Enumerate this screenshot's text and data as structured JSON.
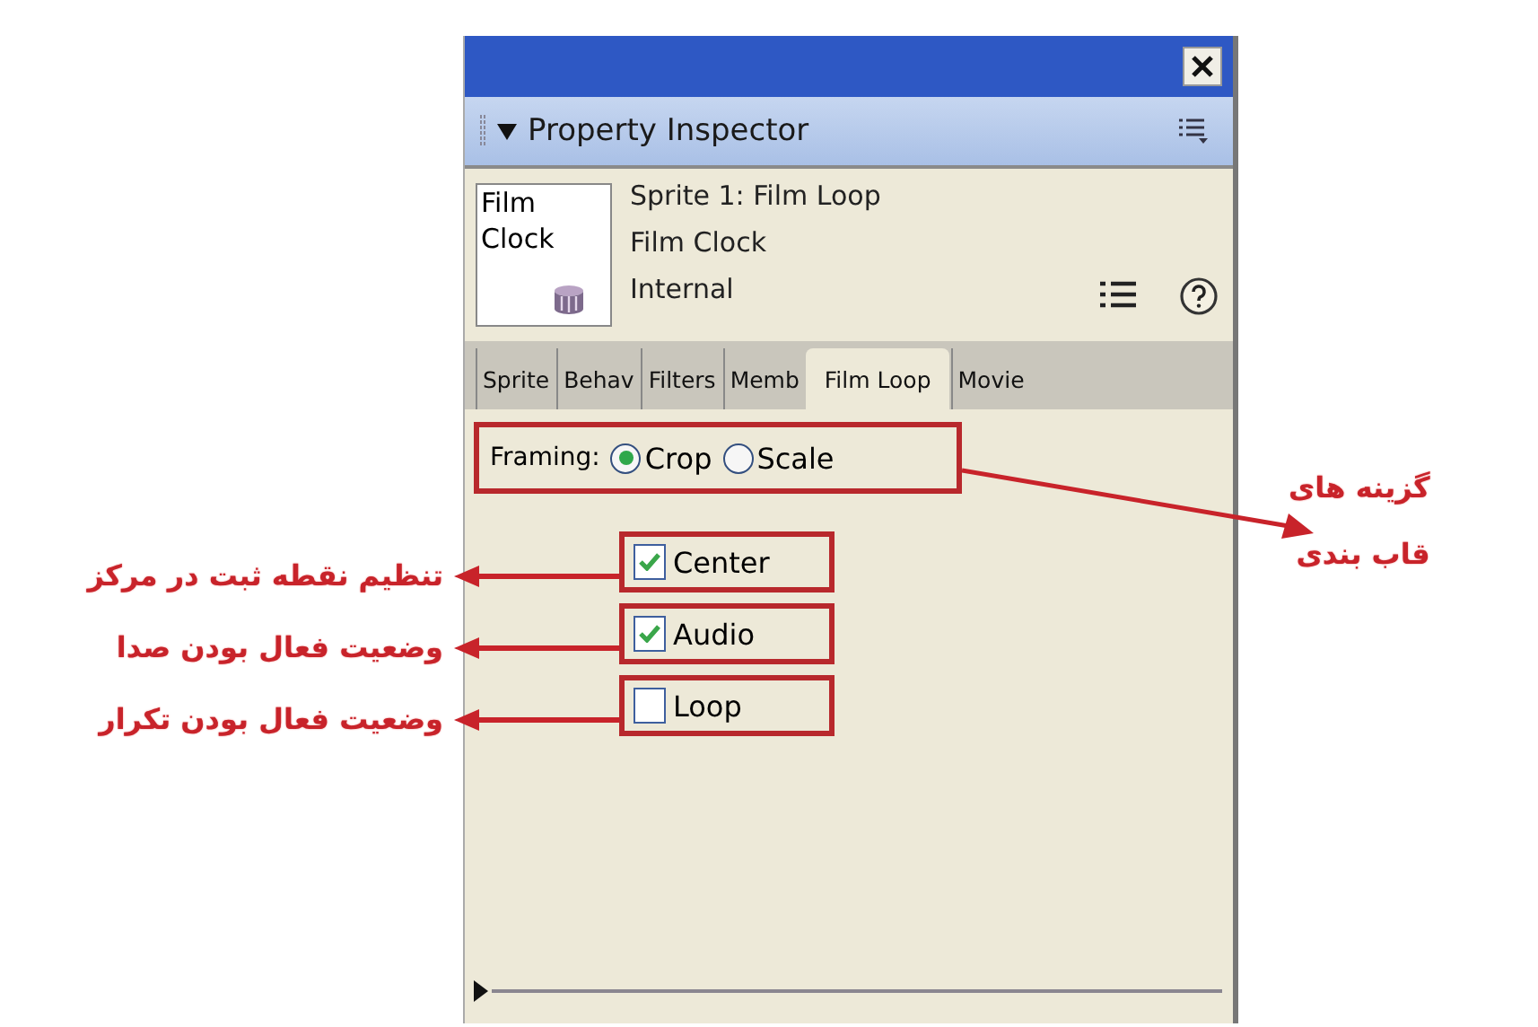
{
  "panel": {
    "title": "Property Inspector"
  },
  "sprite": {
    "thumbnail_lines": [
      "Film",
      "Clock"
    ],
    "lines": [
      "Sprite 1: Film Loop",
      "Film Clock",
      "Internal"
    ]
  },
  "tabs": [
    {
      "label": "Sprite",
      "selected": false
    },
    {
      "label": "Behav",
      "selected": false
    },
    {
      "label": "Filters",
      "selected": false
    },
    {
      "label": "Memb",
      "selected": false
    },
    {
      "label": "Film Loop",
      "selected": true
    },
    {
      "label": "Movie",
      "selected": false
    }
  ],
  "framing": {
    "label": "Framing:",
    "options": [
      {
        "label": "Crop",
        "selected": true
      },
      {
        "label": "Scale",
        "selected": false
      }
    ]
  },
  "checkboxes": [
    {
      "label": "Center",
      "checked": true
    },
    {
      "label": "Audio",
      "checked": true
    },
    {
      "label": "Loop",
      "checked": false
    }
  ],
  "annotations": {
    "framing_note": [
      "گزینه های",
      "قاب بندی"
    ],
    "checkbox_notes": [
      "تنظیم نقطه ثبت در مرکز",
      "وضعیت فعال بودن صدا",
      "وضعیت فعال بودن تکرار"
    ]
  }
}
